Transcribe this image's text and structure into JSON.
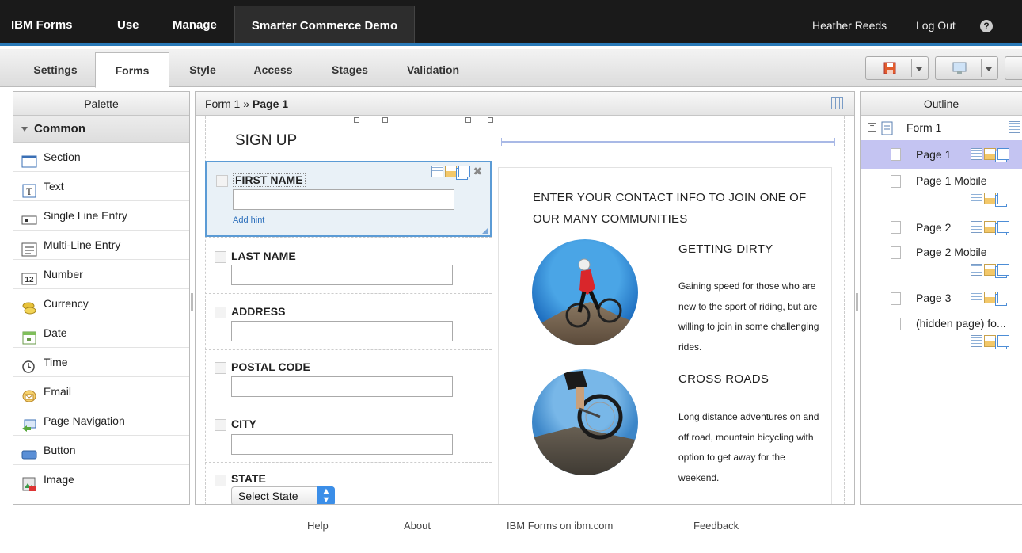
{
  "topbar": {
    "brand": "IBM Forms",
    "use": "Use",
    "manage": "Manage",
    "app_title": "Smarter Commerce Demo",
    "user": "Heather Reeds",
    "logout": "Log Out",
    "help": "?"
  },
  "tabs": [
    "Settings",
    "Forms",
    "Style",
    "Access",
    "Stages",
    "Validation"
  ],
  "active_tab": "Forms",
  "palette": {
    "title": "Palette",
    "group": "Common",
    "items": [
      {
        "label": "Section",
        "icon": "section-icon"
      },
      {
        "label": "Text",
        "icon": "text-icon"
      },
      {
        "label": "Single Line Entry",
        "icon": "single-line-icon"
      },
      {
        "label": "Multi-Line Entry",
        "icon": "multi-line-icon"
      },
      {
        "label": "Number",
        "icon": "number-icon"
      },
      {
        "label": "Currency",
        "icon": "currency-icon"
      },
      {
        "label": "Date",
        "icon": "calendar-icon"
      },
      {
        "label": "Time",
        "icon": "clock-icon"
      },
      {
        "label": "Email",
        "icon": "email-icon"
      },
      {
        "label": "Page Navigation",
        "icon": "page-navigation-icon"
      },
      {
        "label": "Button",
        "icon": "button-icon"
      },
      {
        "label": "Image",
        "icon": "image-icon"
      }
    ],
    "number_badge": "12"
  },
  "canvas": {
    "crumb_form": "Form 1",
    "crumb_sep": " » ",
    "crumb_page": "Page 1",
    "heading": "SIGN UP",
    "fields": [
      {
        "label": "FIRST NAME",
        "hint": "Add hint"
      },
      {
        "label": "LAST NAME"
      },
      {
        "label": "ADDRESS"
      },
      {
        "label": "POSTAL CODE"
      },
      {
        "label": "CITY"
      },
      {
        "label": "STATE",
        "select_value": "Select State"
      }
    ],
    "intro": "ENTER YOUR CONTACT INFO TO JOIN ONE OF OUR MANY COMMUNITIES",
    "cards": [
      {
        "title": "GETTING DIRTY",
        "text": "Gaining speed for those who are new to the sport of riding, but are willing to join in some challenging rides."
      },
      {
        "title": "CROSS ROADS",
        "text": "Long distance adventures on and off road, mountain bicycling with option to get away for the weekend."
      }
    ]
  },
  "outline": {
    "title": "Outline",
    "form": "Form 1",
    "pages": [
      "Page 1",
      "Page 1 Mobile",
      "Page 2",
      "Page 2 Mobile",
      "Page 3",
      "(hidden page) fo..."
    ],
    "selected": "Page 1"
  },
  "footer": [
    "Help",
    "About",
    "IBM Forms on ibm.com",
    "Feedback"
  ],
  "colors": {
    "accent": "#2a7ab8",
    "selection": "#c4c4f2",
    "field_selected": "#e9f1f7"
  }
}
